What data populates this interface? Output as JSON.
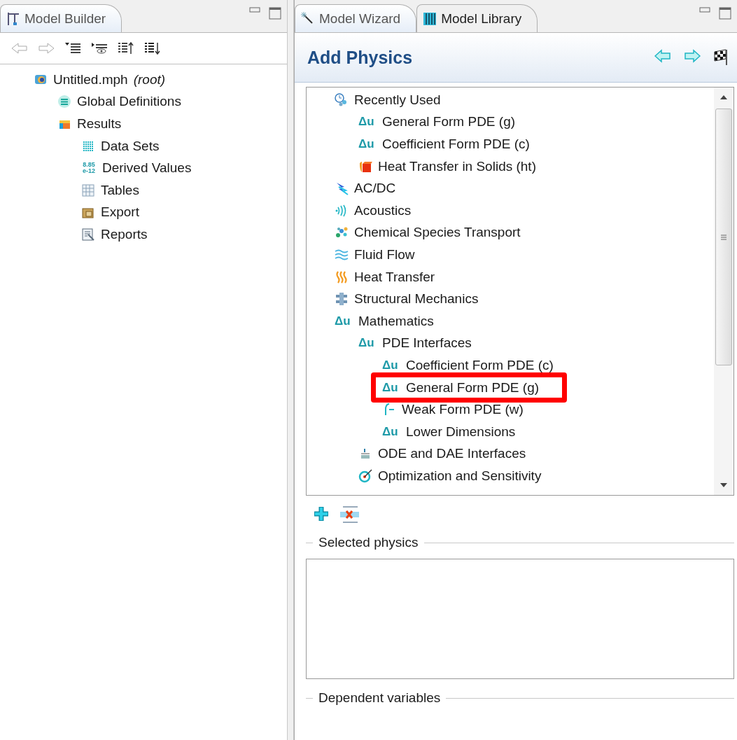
{
  "model_builder": {
    "tab": {
      "label": "Model Builder",
      "selected": true
    },
    "tree": [
      {
        "label": "Untitled.mph",
        "note": "(root)",
        "children": [
          {
            "label": "Global Definitions"
          },
          {
            "label": "Results",
            "children": [
              {
                "label": "Data Sets"
              },
              {
                "label": "Derived Values",
                "symbol": "8.85 e-12"
              },
              {
                "label": "Tables"
              },
              {
                "label": "Export"
              },
              {
                "label": "Reports"
              }
            ]
          }
        ]
      }
    ]
  },
  "model_wizard": {
    "tabs": [
      {
        "label": "Model Wizard",
        "selected": true
      },
      {
        "label": "Model Library",
        "selected": false
      }
    ],
    "title": "Add Physics",
    "physics_tree": [
      {
        "label": "Recently Used",
        "children": [
          {
            "label": "General Form PDE (g)",
            "symbol": "Δu"
          },
          {
            "label": "Coefficient Form PDE (c)",
            "symbol": "Δu"
          },
          {
            "label": "Heat Transfer in Solids (ht)"
          }
        ]
      },
      {
        "label": "AC/DC"
      },
      {
        "label": "Acoustics"
      },
      {
        "label": "Chemical Species Transport"
      },
      {
        "label": "Fluid Flow"
      },
      {
        "label": "Heat Transfer"
      },
      {
        "label": "Structural Mechanics"
      },
      {
        "label": "Mathematics",
        "symbol": "Δu",
        "children": [
          {
            "label": "PDE Interfaces",
            "symbol": "Δu",
            "children": [
              {
                "label": "Coefficient Form PDE (c)",
                "symbol": "Δu",
                "highlighted": false
              },
              {
                "label": "General Form PDE (g)",
                "symbol": "Δu",
                "highlighted": true
              },
              {
                "label": "Weak Form PDE (w)",
                "highlighted": false
              },
              {
                "label": "Lower Dimensions",
                "symbol": "Δu",
                "highlighted": false
              }
            ]
          },
          {
            "label": "ODE and DAE Interfaces"
          },
          {
            "label": "Optimization and Sensitivity"
          }
        ]
      }
    ],
    "selected_physics_label": "Selected physics",
    "dependent_variables_label": "Dependent variables"
  }
}
